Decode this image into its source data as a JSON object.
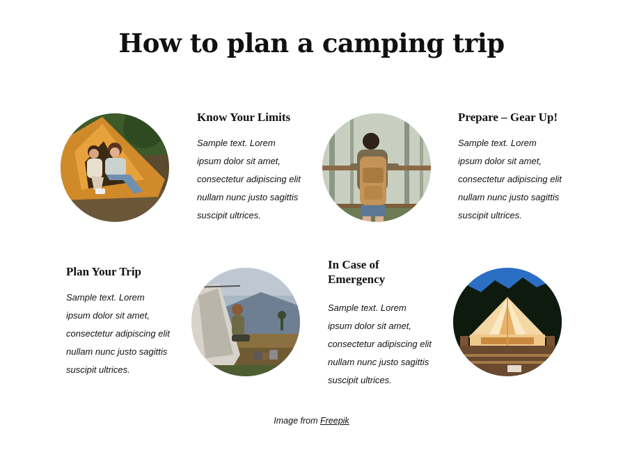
{
  "page": {
    "title": "How to plan a camping trip"
  },
  "cards": [
    {
      "heading": "Know Your Limits",
      "text": "Sample text. Lorem ipsum dolor sit amet, consectetur adipiscing elit nullam nunc justo sagittis suscipit ultrices.",
      "image_subject": "two women sitting inside an orange tent"
    },
    {
      "heading": "Prepare – Gear Up!",
      "text": "Sample text. Lorem ipsum dolor sit amet, consectetur adipiscing elit nullam nunc justo sagittis suscipit ultrices.",
      "image_subject": "hiker with a brown backpack by a wooden fence in a forest"
    },
    {
      "heading": "Plan Your Trip",
      "text": "Sample text. Lorem ipsum dolor sit amet, consectetur adipiscing elit nullam nunc justo sagittis suscipit ultrices.",
      "image_subject": "woman sitting in a white tent overlooking mountains"
    },
    {
      "heading": "In Case of Emergency",
      "text": "Sample text. Lorem ipsum dolor sit amet, consectetur adipiscing elit nullam nunc justo sagittis suscipit ultrices.",
      "image_subject": "glowing bell tent at dusk"
    }
  ],
  "credit": {
    "prefix": "Image from",
    "link_label": "Freepik"
  }
}
